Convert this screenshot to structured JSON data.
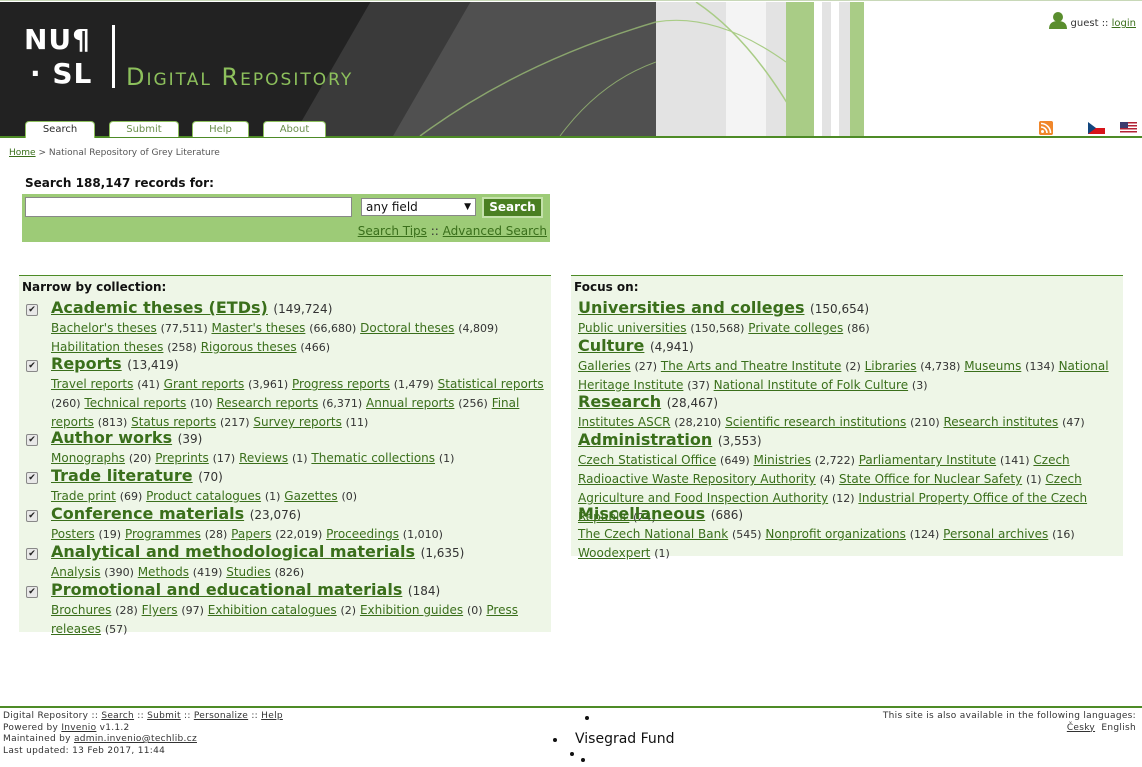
{
  "header": {
    "logo_line1": "NU¶",
    "logo_line2": "· SL",
    "title": "Digital Repository",
    "tabs": [
      "Search",
      "Submit",
      "Help",
      "About"
    ],
    "user": {
      "name": "guest",
      "separator": "::",
      "login": "login"
    },
    "icons": [
      "user-icon",
      "rss-icon",
      "flag-cz-icon",
      "flag-us-icon"
    ]
  },
  "breadcrumb": {
    "home": "Home",
    "separator": ">",
    "current": "National Repository of Grey Literature"
  },
  "search": {
    "label": "Search 188,147 records for:",
    "input_value": "",
    "field_selected": "any field",
    "button": "Search",
    "tips": "Search Tips",
    "sep": "::",
    "advanced": "Advanced Search"
  },
  "narrow": {
    "title": "Narrow by collection:",
    "collections": [
      {
        "name": "Academic theses (ETDs)",
        "count": "(149,724)",
        "subs": [
          [
            "Bachelor's theses",
            "(77,511)"
          ],
          [
            "Master's theses",
            "(66,680)"
          ],
          [
            "Doctoral theses",
            "(4,809)"
          ],
          [
            "Habilitation theses",
            "(258)"
          ],
          [
            "Rigorous theses",
            "(466)"
          ]
        ]
      },
      {
        "name": "Reports",
        "count": "(13,419)",
        "subs": [
          [
            "Travel reports",
            "(41)"
          ],
          [
            "Grant reports",
            "(3,961)"
          ],
          [
            "Progress reports",
            "(1,479)"
          ],
          [
            "Statistical reports",
            "(260)"
          ],
          [
            "Technical reports",
            "(10)"
          ],
          [
            "Research reports",
            "(6,371)"
          ],
          [
            "Annual reports",
            "(256)"
          ],
          [
            "Final reports",
            "(813)"
          ],
          [
            "Status reports",
            "(217)"
          ],
          [
            "Survey reports",
            "(11)"
          ]
        ]
      },
      {
        "name": "Author works",
        "count": "(39)",
        "subs": [
          [
            "Monographs",
            "(20)"
          ],
          [
            "Preprints",
            "(17)"
          ],
          [
            "Reviews",
            "(1)"
          ],
          [
            "Thematic collections",
            "(1)"
          ]
        ]
      },
      {
        "name": "Trade literature",
        "count": "(70)",
        "subs": [
          [
            "Trade print",
            "(69)"
          ],
          [
            "Product catalogues",
            "(1)"
          ],
          [
            "Gazettes",
            "(0)"
          ]
        ]
      },
      {
        "name": "Conference materials",
        "count": "(23,076)",
        "subs": [
          [
            "Posters",
            "(19)"
          ],
          [
            "Programmes",
            "(28)"
          ],
          [
            "Papers",
            "(22,019)"
          ],
          [
            "Proceedings",
            "(1,010)"
          ]
        ]
      },
      {
        "name": "Analytical and methodological materials",
        "count": "(1,635)",
        "subs": [
          [
            "Analysis",
            "(390)"
          ],
          [
            "Methods",
            "(419)"
          ],
          [
            "Studies",
            "(826)"
          ]
        ]
      },
      {
        "name": "Promotional and educational materials",
        "count": "(184)",
        "subs": [
          [
            "Brochures",
            "(28)"
          ],
          [
            "Flyers",
            "(97)"
          ],
          [
            "Exhibition catalogues",
            "(2)"
          ],
          [
            "Exhibition guides",
            "(0)"
          ],
          [
            "Press releases",
            "(57)"
          ]
        ]
      }
    ]
  },
  "focus": {
    "title": "Focus on:",
    "collections": [
      {
        "name": "Universities and colleges",
        "count": "(150,654)",
        "subs": [
          [
            "Public universities",
            "(150,568)"
          ],
          [
            "Private colleges",
            "(86)"
          ]
        ]
      },
      {
        "name": "Culture",
        "count": "(4,941)",
        "subs": [
          [
            "Galleries",
            "(27)"
          ],
          [
            "The Arts and Theatre Institute",
            "(2)"
          ],
          [
            "Libraries",
            "(4,738)"
          ],
          [
            "Museums",
            "(134)"
          ],
          [
            "National Heritage Institute",
            "(37)"
          ],
          [
            "National Institute of Folk Culture",
            "(3)"
          ]
        ]
      },
      {
        "name": "Research",
        "count": "(28,467)",
        "subs": [
          [
            "Institutes ASCR",
            "(28,210)"
          ],
          [
            "Scientific research institutions",
            "(210)"
          ],
          [
            "Research institutes",
            "(47)"
          ]
        ]
      },
      {
        "name": "Administration",
        "count": "(3,553)",
        "subs": [
          [
            "Czech Statistical Office",
            "(649)"
          ],
          [
            "Ministries",
            "(2,722)"
          ],
          [
            "Parliamentary Institute",
            "(141)"
          ],
          [
            "Czech Radioactive Waste Repository Authority",
            "(4)"
          ],
          [
            "State Office for Nuclear Safety",
            "(1)"
          ],
          [
            "Czech Agriculture and Food Inspection Authority",
            "(12)"
          ],
          [
            "Industrial Property Office of the Czech Republic",
            "(24)"
          ]
        ]
      },
      {
        "name": "Miscellaneous",
        "count": "(686)",
        "subs": [
          [
            "The Czech National Bank",
            "(545)"
          ],
          [
            "Nonprofit organizations",
            "(124)"
          ],
          [
            "Personal archives",
            "(16)"
          ],
          [
            "Woodexpert",
            "(1)"
          ]
        ]
      }
    ]
  },
  "footer": {
    "site": "Digital Repository",
    "sep": "::",
    "links": [
      "Search",
      "Submit",
      "Personalize",
      "Help"
    ],
    "powered_prefix": "Powered by",
    "powered_link": "Invenio",
    "powered_version": "v1.1.2",
    "maintained_prefix": "Maintained by",
    "maintained_link": "admin.invenio@techlib.cz",
    "updated": "Last updated: 13 Feb 2017, 11:44",
    "lang_note": "This site is also available in the following languages:",
    "lang_cz": "Česky",
    "lang_en": "English",
    "sponsor": "Visegrad Fund"
  }
}
